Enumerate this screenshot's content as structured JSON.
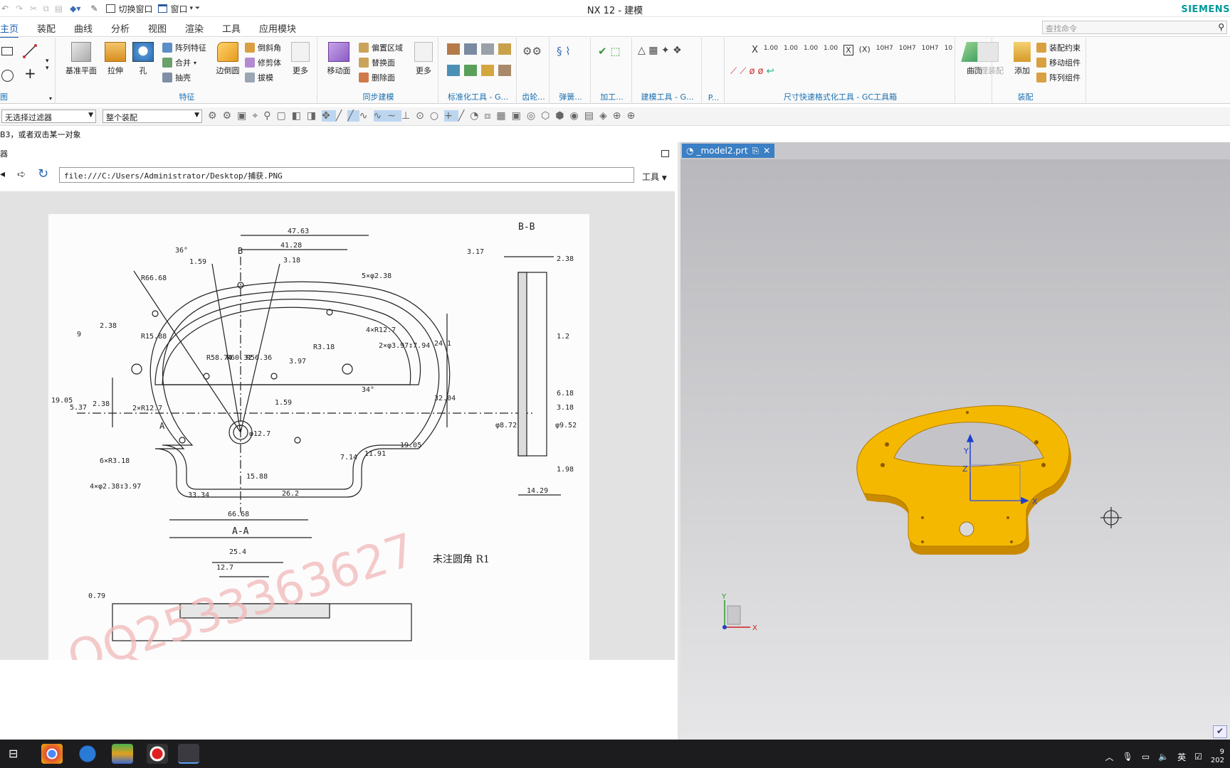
{
  "window": {
    "title": "NX 12 - 建模",
    "brand": "SIEMENS"
  },
  "quick_access": {
    "switch_window": "切换窗口",
    "window_menu": "窗口"
  },
  "menu": {
    "tabs": [
      "主页",
      "装配",
      "曲线",
      "分析",
      "视图",
      "渲染",
      "工具",
      "应用模块"
    ],
    "active": "主页",
    "search_placeholder": "查找命令"
  },
  "ribbon": {
    "groups": {
      "sketch": "图",
      "feature": "特征",
      "sync": "同步建模",
      "std": "标准化工具 - G...",
      "gear": "齿轮...",
      "spring": "弹簧...",
      "machining": "加工...",
      "modeling_tools": "建模工具 - G...",
      "p": "P...",
      "dimension": "尺寸快速格式化工具 - GC工具箱",
      "assembly": "装配"
    },
    "feature_buttons": {
      "datum_plane": "基准平面",
      "extrude": "拉伸",
      "hole": "孔",
      "pattern_feature": "阵列特征",
      "unite": "合并",
      "shell": "抽壳",
      "edge_blend": "边倒圆",
      "chamfer": "倒斜角",
      "trim_body": "修剪体",
      "draft": "拔模",
      "more": "更多"
    },
    "sync_buttons": {
      "move_face": "移动面",
      "offset_region": "偏置区域",
      "replace_face": "替换面",
      "delete_face": "删除面",
      "more": "更多"
    },
    "surface": "曲面",
    "assembly_buttons": {
      "process_assembly": "处理装配",
      "add": "添加",
      "assembly_constraint": "装配约束",
      "move_component": "移动组件",
      "pattern_component": "阵列组件"
    },
    "dimension_labels": [
      "1.00",
      "1.00",
      "1.00",
      "1.00",
      "10H7",
      "10H7",
      "10H7",
      "10"
    ]
  },
  "filterbar": {
    "selection_filter": "无选择过滤器",
    "assembly_scope": "整个装配"
  },
  "prompt": "B3，或者双击某一对象",
  "browser": {
    "title": "器",
    "url": "file:///C:/Users/Administrator/Desktop/捕获.PNG",
    "tools": "工具"
  },
  "drawing": {
    "section_bb": "B-B",
    "section_aa": "A-A",
    "note": "未注圆角 R1",
    "watermark": "QQ2533363627",
    "dims": [
      "47.63",
      "41.28",
      "3.18",
      "1.59",
      "36°",
      "R66.68",
      "5×φ2.38",
      "4×R12.7",
      "2×φ3.97↧7.94",
      "R3.18",
      "34°",
      "9",
      "2.38",
      "R15.88",
      "R58.74",
      "R60.32",
      "R56.36",
      "3.97",
      "24.1",
      "19.05",
      "5.37",
      "2.38",
      "2×R12.7",
      "1.59",
      "32.04",
      "φ12.7",
      "7.14",
      "11.91",
      "19.05",
      "6×R3.18",
      "4×φ2.38↧3.97",
      "15.88",
      "26.2",
      "33.34",
      "66.68",
      "25.4",
      "12.7",
      "0.79",
      "3.17",
      "2.38",
      "1.2",
      "6.18",
      "3.18",
      "φ8.72",
      "φ9.52",
      "1.98",
      "14.29",
      "B",
      "A"
    ]
  },
  "viewport": {
    "tab": "_model2.prt",
    "axis_x": "X",
    "axis_y": "Y",
    "axis_z": "Z",
    "triad_x": "X",
    "triad_y": "Y"
  },
  "taskbar": {
    "ime": "英",
    "time_partial": "9",
    "date_partial": "202"
  },
  "colors": {
    "accent": "#1a5fb4",
    "brand": "#009999",
    "part": "#f0b400",
    "taskbar": "#1c1c1e"
  }
}
